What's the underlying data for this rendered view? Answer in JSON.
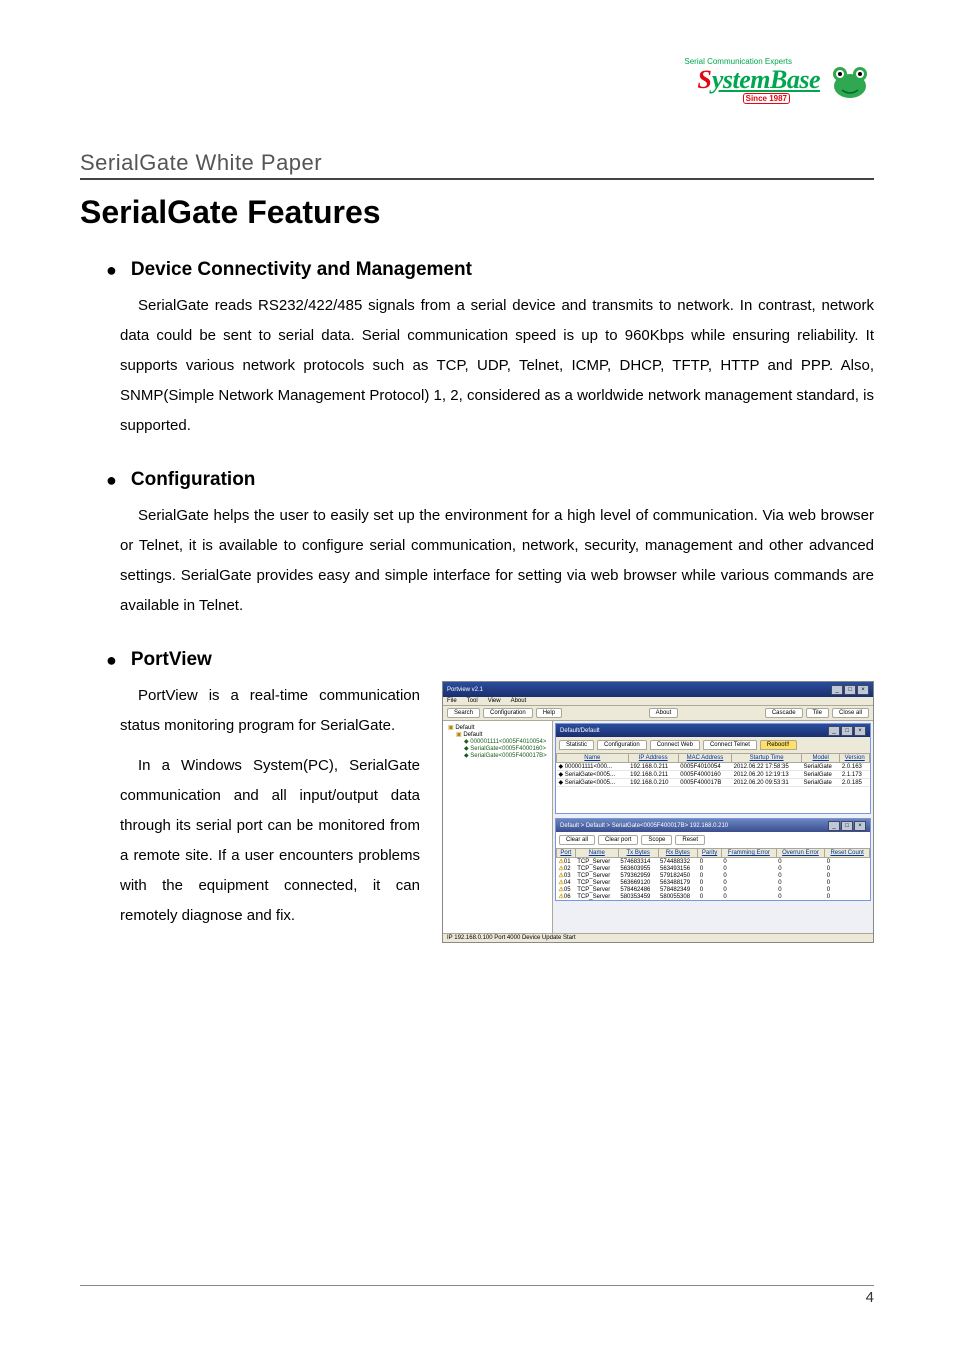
{
  "logo": {
    "tagline": "Serial Communication Experts",
    "brand_first": "S",
    "brand_rest": "ystemBase",
    "since": "Since 1987"
  },
  "doc": {
    "subtitle": "SerialGate White Paper",
    "h1": "SerialGate Features",
    "page_number": "4"
  },
  "sections": {
    "connectivity": {
      "title": "Device Connectivity and Management",
      "body": "SerialGate reads RS232/422/485 signals from a serial device and transmits to network. In contrast, network data could be sent to serial data. Serial communication speed is up to 960Kbps while ensuring reliability. It supports various network protocols such as TCP, UDP, Telnet, ICMP, DHCP, TFTP, HTTP and PPP. Also, SNMP(Simple Network Management Protocol) 1, 2, considered as a worldwide network management standard, is supported."
    },
    "configuration": {
      "title": "Configuration",
      "body": "SerialGate helps the user to easily set up the environment for a high level of communication. Via web browser or Telnet, it is available to configure serial communication, network, security, management and other advanced settings. SerialGate provides easy and simple interface for setting via web browser while various commands are available in Telnet."
    },
    "portview": {
      "title": "PortView",
      "body1": "PortView is a real-time communication status monitoring program for SerialGate.",
      "body2": "In a Windows System(PC), SerialGate communication and all input/output data through its serial port can be monitored from a remote site. If a user encounters problems with the equipment connected, it can remotely diagnose and fix."
    }
  },
  "screenshot": {
    "title": "Portview v2.1",
    "menus": [
      "File",
      "Tool",
      "View",
      "About"
    ],
    "toolbar_left": [
      "Search",
      "Configuration",
      "Help"
    ],
    "toolbar_mid": [
      "About"
    ],
    "toolbar_right": [
      "Cascade",
      "Tile",
      "Close all"
    ],
    "tree_root": "Default",
    "tree_group": "Default",
    "tree_items": [
      "000001111<0005F4010054>",
      "SerialGate<0005F4000160>",
      "SerialGate<0005F400017B>"
    ],
    "top_window_title": "Default/Default",
    "tabs": [
      "Statistic",
      "Configuration",
      "Connect Web",
      "Connect Telnet",
      "Reboot!!"
    ],
    "dev_headers": [
      "Name",
      "IP Address",
      "MAC Address",
      "Startup Time",
      "Model",
      "Version"
    ],
    "dev_rows": [
      [
        "000001111<000...",
        "192.168.0.211",
        "0005F4010054",
        "2012.06.22 17:58:35",
        "SerialGate",
        "2.0.163"
      ],
      [
        "SerialGate<0005...",
        "192.168.0.211",
        "0005F4000160",
        "2012.06.20 12:19:13",
        "SerialGate",
        "2.1.173"
      ],
      [
        "SerialGate<0005...",
        "192.168.0.210",
        "0005F400017B",
        "2012.06.20 09:53:31",
        "SerialGate",
        "2.0.185"
      ]
    ],
    "bottom_window_title": "Default > Default > SerialGate<0005F400017B> 192.168.0.210",
    "port_buttons": [
      "Clear all",
      "Clear port",
      "Scope",
      "Reset"
    ],
    "port_headers": [
      "Port",
      "Name",
      "Tx Bytes",
      "Rx Bytes",
      "Parity",
      "Framming Error",
      "Overrun Error",
      "Reset Count"
    ],
    "port_rows": [
      [
        "01",
        "TCP_Server",
        "574683314",
        "574488332",
        "0",
        "0",
        "0",
        "0"
      ],
      [
        "02",
        "TCP_Server",
        "563603955",
        "563493156",
        "0",
        "0",
        "0",
        "0"
      ],
      [
        "03",
        "TCP_Server",
        "579362959",
        "579182450",
        "0",
        "0",
        "0",
        "0"
      ],
      [
        "04",
        "TCP_Server",
        "563669120",
        "563488179",
        "0",
        "0",
        "0",
        "0"
      ],
      [
        "05",
        "TCP_Server",
        "578462486",
        "578482349",
        "0",
        "0",
        "0",
        "0"
      ],
      [
        "06",
        "TCP_Server",
        "580353459",
        "580055308",
        "0",
        "0",
        "0",
        "0"
      ]
    ],
    "statusbar": "IP 192.168.0.100   Port 4000   Device Update Start"
  }
}
